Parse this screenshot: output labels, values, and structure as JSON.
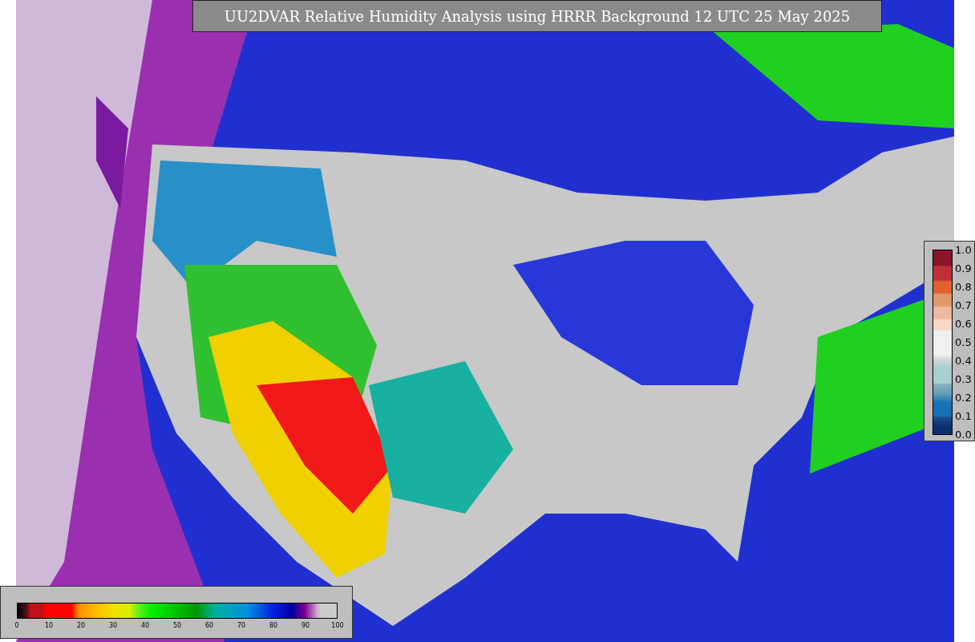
{
  "title": "UU2DVAR Relative Humidity Analysis using HRRR Background 12 UTC 25 May 2025",
  "humidity_legend": {
    "ticks": [
      "0",
      "10",
      "20",
      "30",
      "40",
      "50",
      "60",
      "70",
      "80",
      "90",
      "100"
    ]
  },
  "ratio_legend": {
    "ticks": [
      "1.0",
      "0.9",
      "0.8",
      "0.7",
      "0.6",
      "0.5",
      "0.4",
      "0.3",
      "0.2",
      "0.1",
      "0.0"
    ]
  }
}
